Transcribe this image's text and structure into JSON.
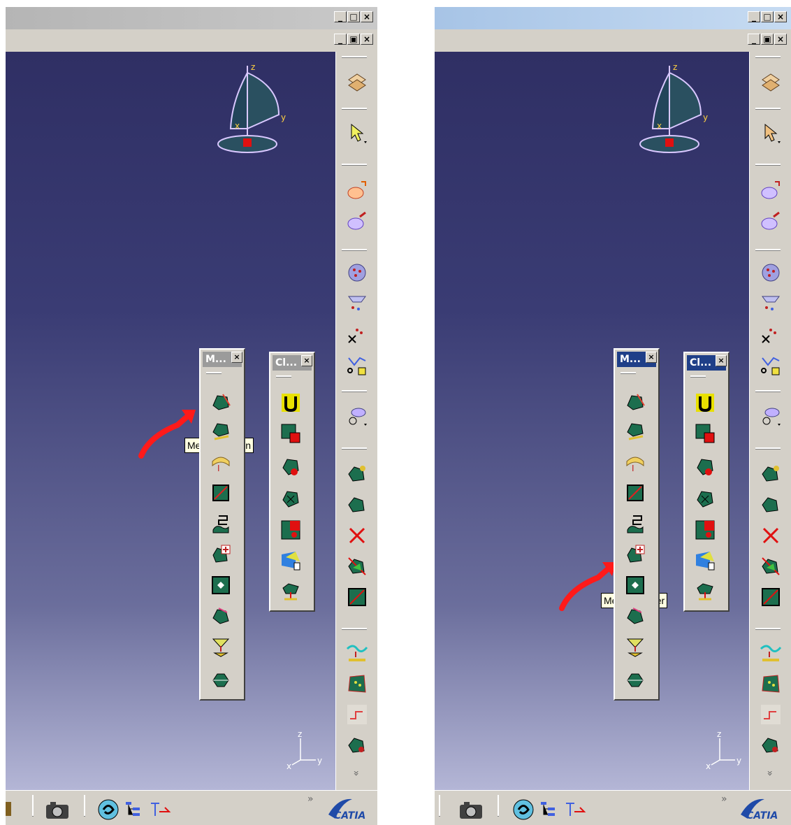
{
  "window_buttons": {
    "minimize": "_",
    "maximize": "□",
    "restore": "▣",
    "close": "×"
  },
  "left": {
    "mesh_toolbar": {
      "title": "M..."
    },
    "clean_toolbar": {
      "title": "Cl..."
    },
    "tooltip": "Mesh Creation"
  },
  "right": {
    "mesh_toolbar": {
      "title": "M..."
    },
    "clean_toolbar": {
      "title": "Cl..."
    },
    "tooltip": "Mesh Cleaner"
  },
  "compass_axes": {
    "z": "z",
    "x": "x",
    "y": "y"
  },
  "brand": {
    "logo_text": "CATIA"
  },
  "overflow_glyph": "»",
  "colors": {
    "annotation_arrow": "#ff1a1a",
    "viewport_top": "#2f2f64",
    "viewport_bottom": "#b4b6d6"
  }
}
